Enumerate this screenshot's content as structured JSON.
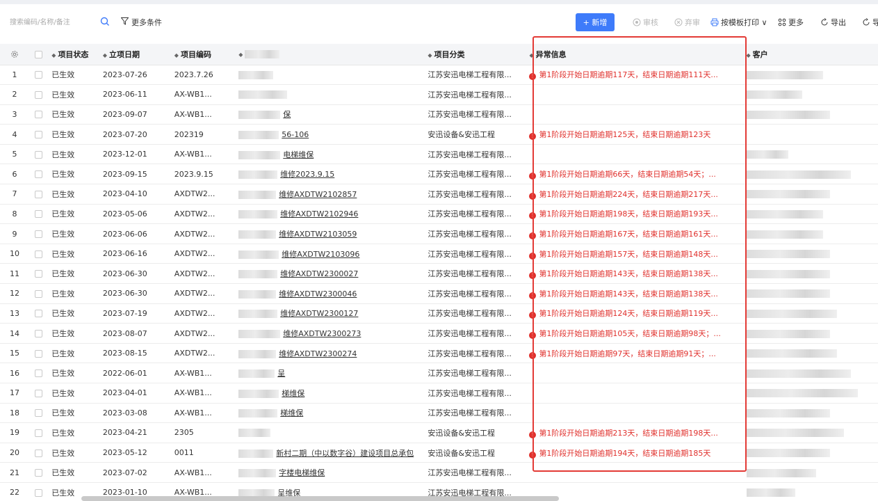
{
  "toolbar": {
    "search_placeholder": "搜索编码/名称/备注",
    "more_conditions": "更多条件",
    "new_label": "+ 新增",
    "approve_label": "审核",
    "abandon_label": "弃审",
    "print_label": "按模板打印 ∨",
    "more_label": "更多",
    "export_label": "导出",
    "export2_label": "导",
    "accent": "#3e7bfa"
  },
  "table": {
    "columns": [
      "",
      "项目状态",
      "立项日期",
      "项目编码",
      "",
      "项目分类",
      "异常信息",
      "客户"
    ],
    "rows": [
      {
        "no": "1",
        "status": "已生效",
        "date": "2023-07-26",
        "code": "2023.7.26",
        "name": "",
        "category": "江苏安迅电梯工程有限...",
        "error": "第1阶段开始日期逾期117天，结束日期逾期111天..."
      },
      {
        "no": "2",
        "status": "已生效",
        "date": "2023-06-11",
        "code": "AX-WB1...",
        "name": "",
        "category": "江苏安迅电梯工程有限...",
        "error": ""
      },
      {
        "no": "3",
        "status": "已生效",
        "date": "2023-09-07",
        "code": "AX-WB1...",
        "name": "保",
        "category": "江苏安迅电梯工程有限...",
        "error": ""
      },
      {
        "no": "4",
        "status": "已生效",
        "date": "2023-07-20",
        "code": "202319",
        "name": "56-106",
        "category": "安迅设备&安迅工程",
        "error": "第1阶段开始日期逾期125天，结束日期逾期123天"
      },
      {
        "no": "5",
        "status": "已生效",
        "date": "2023-12-01",
        "code": "AX-WB1...",
        "name": "电梯维保",
        "category": "江苏安迅电梯工程有限...",
        "error": ""
      },
      {
        "no": "6",
        "status": "已生效",
        "date": "2023-09-15",
        "code": "2023.9.15",
        "name": "维修2023.9.15",
        "category": "江苏安迅电梯工程有限...",
        "error": "第1阶段开始日期逾期66天，结束日期逾期54天；..."
      },
      {
        "no": "7",
        "status": "已生效",
        "date": "2023-04-10",
        "code": "AXDTW2...",
        "name": "维修AXDTW2102857",
        "category": "江苏安迅电梯工程有限...",
        "error": "第1阶段开始日期逾期224天，结束日期逾期217天..."
      },
      {
        "no": "8",
        "status": "已生效",
        "date": "2023-05-06",
        "code": "AXDTW2...",
        "name": "维修AXDTW2102946",
        "category": "江苏安迅电梯工程有限...",
        "error": "第1阶段开始日期逾期198天，结束日期逾期193天..."
      },
      {
        "no": "9",
        "status": "已生效",
        "date": "2023-06-06",
        "code": "AXDTW2...",
        "name": "维修AXDTW2103059",
        "category": "江苏安迅电梯工程有限...",
        "error": "第1阶段开始日期逾期167天，结束日期逾期161天..."
      },
      {
        "no": "10",
        "status": "已生效",
        "date": "2023-06-16",
        "code": "AXDTW2...",
        "name": "维修AXDTW2103096",
        "category": "江苏安迅电梯工程有限...",
        "error": "第1阶段开始日期逾期157天，结束日期逾期148天..."
      },
      {
        "no": "11",
        "status": "已生效",
        "date": "2023-06-30",
        "code": "AXDTW2...",
        "name": "维修AXDTW2300027",
        "category": "江苏安迅电梯工程有限...",
        "error": "第1阶段开始日期逾期143天，结束日期逾期138天..."
      },
      {
        "no": "12",
        "status": "已生效",
        "date": "2023-06-30",
        "code": "AXDTW2...",
        "name": "维修AXDTW2300046",
        "category": "江苏安迅电梯工程有限...",
        "error": "第1阶段开始日期逾期143天，结束日期逾期138天..."
      },
      {
        "no": "13",
        "status": "已生效",
        "date": "2023-07-19",
        "code": "AXDTW2...",
        "name": "维修AXDTW2300127",
        "category": "江苏安迅电梯工程有限...",
        "error": "第1阶段开始日期逾期124天，结束日期逾期119天..."
      },
      {
        "no": "14",
        "status": "已生效",
        "date": "2023-08-07",
        "code": "AXDTW2...",
        "name": "维修AXDTW2300273",
        "category": "江苏安迅电梯工程有限...",
        "error": "第1阶段开始日期逾期105天，结束日期逾期98天；..."
      },
      {
        "no": "15",
        "status": "已生效",
        "date": "2023-08-15",
        "code": "AXDTW2...",
        "name": "维修AXDTW2300274",
        "category": "江苏安迅电梯工程有限...",
        "error": "第1阶段开始日期逾期97天，结束日期逾期91天；..."
      },
      {
        "no": "16",
        "status": "已生效",
        "date": "2022-06-01",
        "code": "AX-WB1...",
        "name": "呈",
        "category": "江苏安迅电梯工程有限...",
        "error": ""
      },
      {
        "no": "17",
        "status": "已生效",
        "date": "2023-04-01",
        "code": "AX-WB1...",
        "name": "梯维保",
        "category": "江苏安迅电梯工程有限...",
        "error": ""
      },
      {
        "no": "18",
        "status": "已生效",
        "date": "2023-03-08",
        "code": "AX-WB1...",
        "name": "梯维保",
        "category": "江苏安迅电梯工程有限...",
        "error": ""
      },
      {
        "no": "19",
        "status": "已生效",
        "date": "2023-04-21",
        "code": "2305",
        "name": "",
        "category": "安迅设备&安迅工程",
        "error": "第1阶段开始日期逾期213天，结束日期逾期198天..."
      },
      {
        "no": "20",
        "status": "已生效",
        "date": "2023-05-12",
        "code": "0011",
        "name": "新村二期（中以数字谷）建设项目总承包",
        "category": "安迅设备&安迅工程",
        "error": "第1阶段开始日期逾期194天，结束日期逾期185天"
      },
      {
        "no": "21",
        "status": "已生效",
        "date": "2023-07-02",
        "code": "AX-WB1...",
        "name": "字楼电梯维保",
        "category": "江苏安迅电梯工程有限...",
        "error": ""
      },
      {
        "no": "22",
        "status": "已生效",
        "date": "2023-01-10",
        "code": "AX-WB1...",
        "name": "呈维保",
        "category": "江苏安迅电梯工程有限...",
        "error": ""
      }
    ]
  }
}
